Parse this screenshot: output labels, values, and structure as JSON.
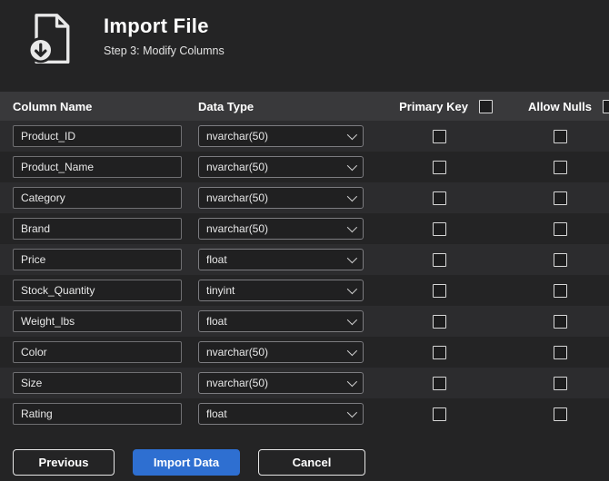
{
  "header": {
    "title": "Import File",
    "subtitle": "Step 3: Modify Columns"
  },
  "icons": {
    "file_import": "file-import-icon",
    "chevron": "chevron-down-icon"
  },
  "colors": {
    "accent": "#2e6fd1",
    "background": "#242425",
    "header_band": "#39393b"
  },
  "table": {
    "headers": {
      "column_name": "Column Name",
      "data_type": "Data Type",
      "primary_key": "Primary Key",
      "allow_nulls": "Allow Nulls"
    },
    "rows": [
      {
        "name": "Product_ID",
        "type": "nvarchar(50)",
        "primary_key": false,
        "allow_nulls": false
      },
      {
        "name": "Product_Name",
        "type": "nvarchar(50)",
        "primary_key": false,
        "allow_nulls": false
      },
      {
        "name": "Category",
        "type": "nvarchar(50)",
        "primary_key": false,
        "allow_nulls": false
      },
      {
        "name": "Brand",
        "type": "nvarchar(50)",
        "primary_key": false,
        "allow_nulls": false
      },
      {
        "name": "Price",
        "type": "float",
        "primary_key": false,
        "allow_nulls": false
      },
      {
        "name": "Stock_Quantity",
        "type": "tinyint",
        "primary_key": false,
        "allow_nulls": false
      },
      {
        "name": "Weight_lbs",
        "type": "float",
        "primary_key": false,
        "allow_nulls": false
      },
      {
        "name": "Color",
        "type": "nvarchar(50)",
        "primary_key": false,
        "allow_nulls": false
      },
      {
        "name": "Size",
        "type": "nvarchar(50)",
        "primary_key": false,
        "allow_nulls": false
      },
      {
        "name": "Rating",
        "type": "float",
        "primary_key": false,
        "allow_nulls": false
      }
    ]
  },
  "footer": {
    "previous_label": "Previous",
    "import_label": "Import Data",
    "cancel_label": "Cancel"
  }
}
